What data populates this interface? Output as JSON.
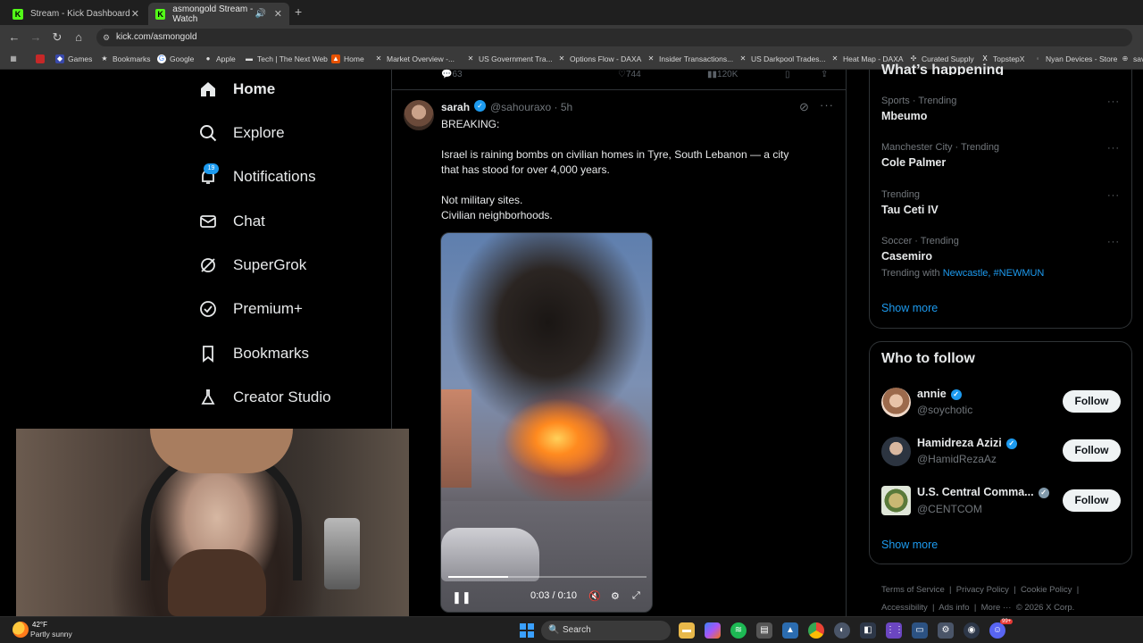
{
  "browser": {
    "tabs": [
      {
        "title": "Stream - Kick Dashboard",
        "icon": "kick-icon"
      },
      {
        "title": "asmongold Stream - Watch",
        "icon": "kick-icon",
        "active": true
      }
    ],
    "url": "kick.com/asmongold",
    "bookmarks": [
      "Games",
      "Bookmarks",
      "Google",
      "Apple",
      "Tech | The Next Web",
      "Home",
      "Market Overview -...",
      "US Government Tra...",
      "Options Flow - DAXA",
      "Insider Transactions...",
      "US Darkpool Trades...",
      "Heat Map - DAXA",
      "Curated Supply",
      "TopstepX",
      "Nyan Devices - Store",
      "sav"
    ]
  },
  "nav": {
    "items": [
      "Home",
      "Explore",
      "Notifications",
      "Chat",
      "SuperGrok",
      "Premium+",
      "Bookmarks",
      "Creator Studio"
    ],
    "notifications_badge": "19"
  },
  "prev_actions": {
    "replies": "63",
    "views": "744",
    "stats": "120K"
  },
  "tweet": {
    "name": "sarah",
    "handle": "@sahouraxo · 5h",
    "line1": "BREAKING:",
    "line2": "Israel is raining bombs on civilian homes in Tyre, South Lebanon — a city",
    "line3": "that has stood for over 4,000 years.",
    "line4": "Not military sites.",
    "line5": "Civilian neighborhoods.",
    "video": {
      "time": "0:03 / 0:10",
      "progress": 0.3
    }
  },
  "trends": {
    "title": "What’s happening",
    "items": [
      {
        "meta": "Sports · Trending",
        "name": "Mbeumo"
      },
      {
        "meta": "Manchester City · Trending",
        "name": "Cole Palmer"
      },
      {
        "meta": "Trending",
        "name": "Tau Ceti IV"
      },
      {
        "meta": "Soccer · Trending",
        "name": "Casemiro",
        "with_prefix": "Trending with ",
        "with_links": "Newcastle, #NEWMUN"
      }
    ],
    "show_more": "Show more"
  },
  "who_to_follow": {
    "title": "Who to follow",
    "accounts": [
      {
        "name": "annie",
        "handle": "@soychotic"
      },
      {
        "name": "Hamidreza Azizi",
        "handle": "@HamidRezaAz"
      },
      {
        "name": "U.S. Central Comma...",
        "handle": "@CENTCOM"
      }
    ],
    "follow_label": "Follow",
    "show_more": "Show more"
  },
  "footer": {
    "links": [
      "Terms of Service",
      "Privacy Policy",
      "Cookie Policy",
      "Accessibility",
      "Ads info",
      "More ···",
      "© 2026 X Corp."
    ]
  },
  "taskbar": {
    "temp": "42°F",
    "weather": "Partly sunny",
    "search_placeholder": "Search",
    "badge": "99+"
  },
  "colors": {
    "accent": "#1d9bf0",
    "kick": "#53fc18",
    "background": "#000000"
  }
}
